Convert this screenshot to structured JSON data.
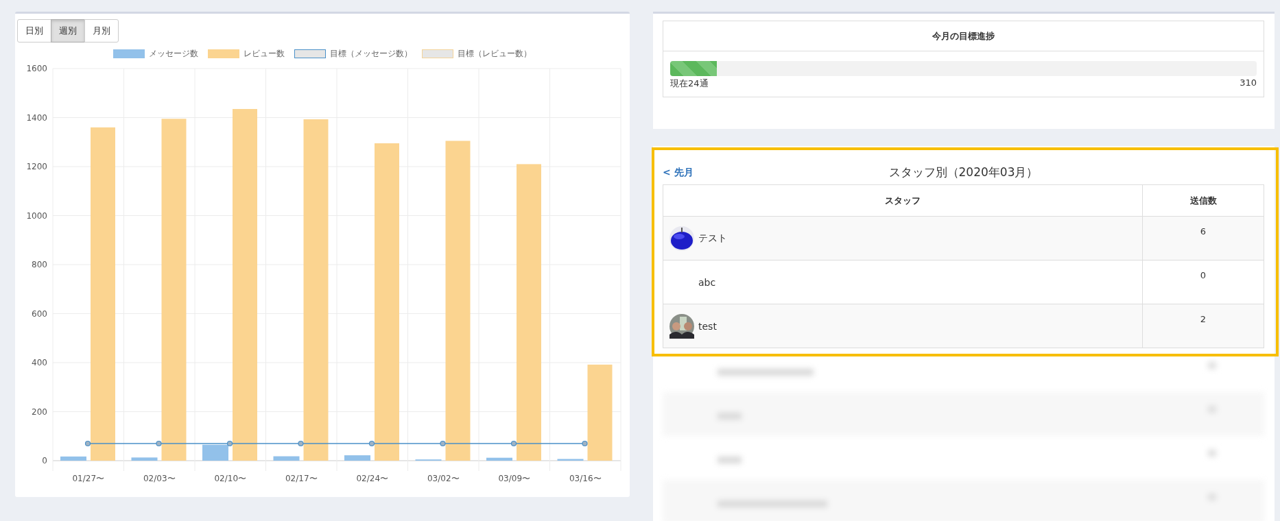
{
  "period_tabs": [
    {
      "label": "日別",
      "selected": false
    },
    {
      "label": "週別",
      "selected": true
    },
    {
      "label": "月別",
      "selected": false
    }
  ],
  "chart_data": {
    "type": "bar",
    "grid": true,
    "categories": [
      "01/27〜",
      "02/03〜",
      "02/10〜",
      "02/17〜",
      "02/24〜",
      "03/02〜",
      "03/09〜",
      "03/16〜"
    ],
    "ylim": [
      0,
      1600
    ],
    "yticks": [
      0,
      200,
      400,
      600,
      800,
      1000,
      1200,
      1400,
      1600
    ],
    "series": [
      {
        "name": "メッセージ数",
        "color": "#92c1ea",
        "type": "bar",
        "values": [
          17,
          13,
          65,
          18,
          22,
          5,
          12,
          7
        ]
      },
      {
        "name": "レビュー数",
        "color": "#fbd490",
        "type": "bar",
        "values": [
          1360,
          1395,
          1435,
          1393,
          1295,
          1305,
          1210,
          392
        ]
      },
      {
        "name": "目標（メッセージ数）",
        "color": "#4a90c8",
        "type": "line",
        "marker": "circle",
        "values": [
          70,
          70,
          70,
          70,
          70,
          70,
          70,
          70
        ]
      },
      {
        "name": "目標（レビュー数）",
        "color": "#f3d39a",
        "type": "line",
        "values": [
          null,
          null,
          null,
          null,
          null,
          null,
          null,
          null
        ]
      }
    ]
  },
  "goal": {
    "title": "今月の目標進捗",
    "level": 0.08,
    "current": "現在24通",
    "target": "310"
  },
  "staff": {
    "prev_link": "< 先月",
    "title": "スタッフ別（2020年03月）",
    "columns": [
      "スタッフ",
      "送信数"
    ],
    "rows": [
      {
        "name": "テスト",
        "count": "6"
      },
      {
        "name": "abc",
        "count": "0"
      },
      {
        "name": "test",
        "count": "2"
      }
    ]
  }
}
